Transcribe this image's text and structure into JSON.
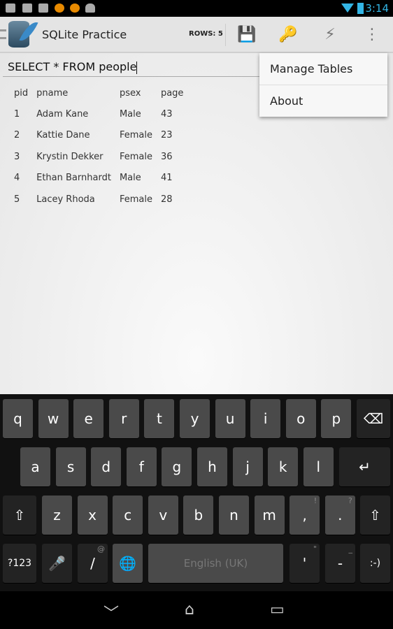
{
  "status": {
    "time": "3:14",
    "icons": [
      "keyboard-icon",
      "image-icon",
      "gmail-icon",
      "app-icon",
      "app-icon",
      "android-icon"
    ]
  },
  "actionbar": {
    "title": "SQLite Practice",
    "rows": "ROWS: 5",
    "actions": [
      "save-icon",
      "key-icon",
      "execute-icon",
      "overflow-icon"
    ]
  },
  "query": {
    "value": "SELECT * FROM people"
  },
  "table": {
    "headers": [
      "pid",
      "pname",
      "psex",
      "page"
    ],
    "rows": [
      [
        "1",
        "Adam Kane",
        "Male",
        "43"
      ],
      [
        "2",
        "Kattie Dane",
        "Female",
        "23"
      ],
      [
        "3",
        "Krystin Dekker",
        "Female",
        "36"
      ],
      [
        "4",
        "Ethan Barnhardt",
        "Male",
        "41"
      ],
      [
        "5",
        "Lacey Rhoda",
        "Female",
        "28"
      ]
    ]
  },
  "menu": {
    "items": [
      "Manage Tables",
      "About"
    ]
  },
  "keyboard": {
    "rows": [
      [
        {
          "l": "q"
        },
        {
          "l": "w"
        },
        {
          "l": "e"
        },
        {
          "l": "r"
        },
        {
          "l": "t"
        },
        {
          "l": "y"
        },
        {
          "l": "u"
        },
        {
          "l": "i"
        },
        {
          "l": "o"
        },
        {
          "l": "p"
        },
        {
          "l": "⌫",
          "n": "backspace"
        }
      ],
      [
        {
          "l": "a"
        },
        {
          "l": "s"
        },
        {
          "l": "d"
        },
        {
          "l": "f"
        },
        {
          "l": "g"
        },
        {
          "l": "h"
        },
        {
          "l": "j"
        },
        {
          "l": "k"
        },
        {
          "l": "l"
        },
        {
          "l": "↵",
          "n": "enter"
        }
      ],
      [
        {
          "l": "⇧",
          "n": "shift"
        },
        {
          "l": "z"
        },
        {
          "l": "x"
        },
        {
          "l": "c"
        },
        {
          "l": "v"
        },
        {
          "l": "b"
        },
        {
          "l": "n"
        },
        {
          "l": "m"
        },
        {
          "l": ",",
          "h": "!"
        },
        {
          "l": ".",
          "h": "?"
        },
        {
          "l": "⇧",
          "n": "shift"
        }
      ],
      [
        {
          "l": "?123",
          "n": "symbols"
        },
        {
          "l": "🎤",
          "n": "mic"
        },
        {
          "l": "/",
          "h": "@"
        },
        {
          "l": "🌐",
          "n": "globe"
        },
        {
          "l": "English (UK)",
          "n": "space"
        },
        {
          "l": "'",
          "h": "\""
        },
        {
          "l": "-",
          "h": "_"
        },
        {
          "l": ":-)",
          "n": "emoticon"
        }
      ]
    ]
  },
  "nav": [
    "back",
    "home",
    "recents"
  ]
}
